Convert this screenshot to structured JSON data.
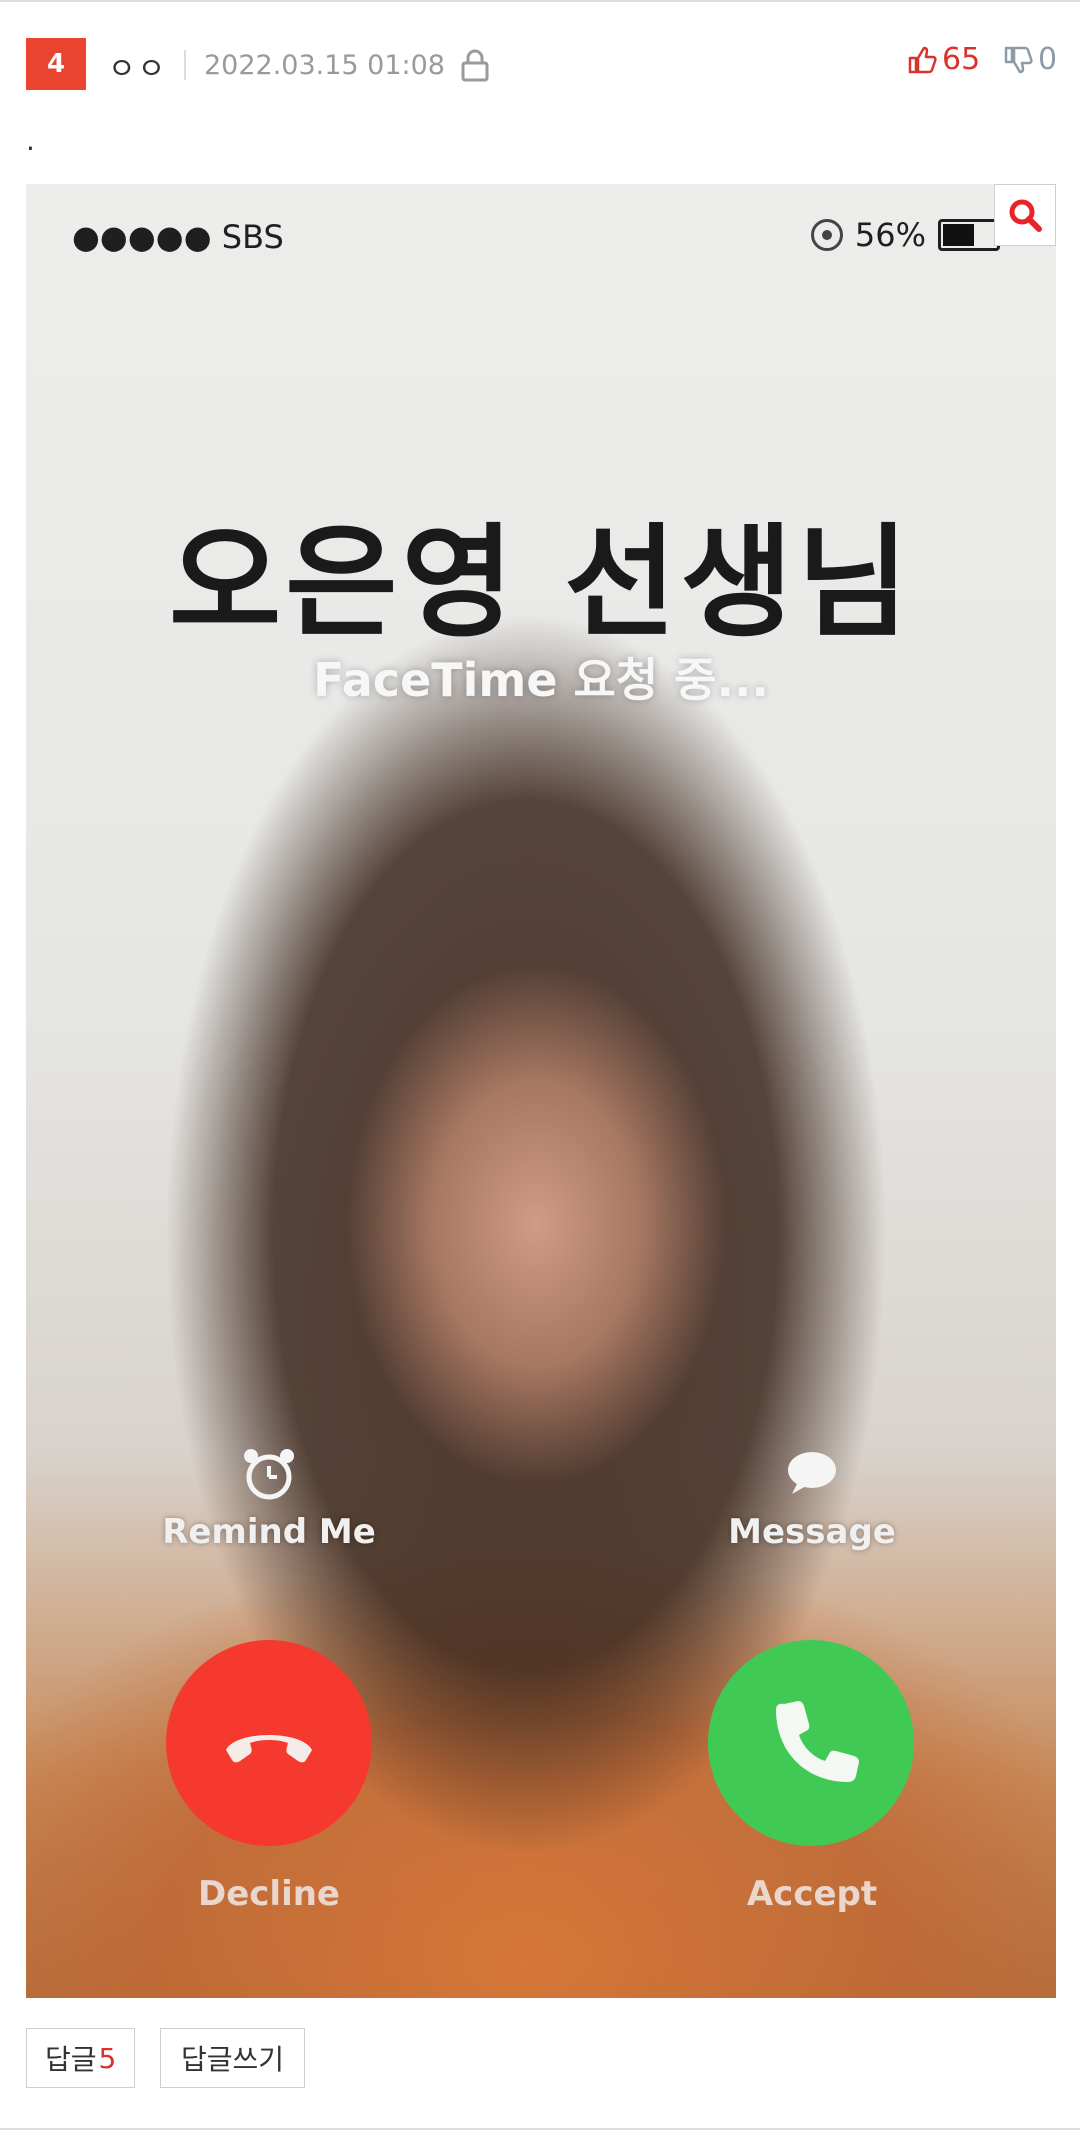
{
  "post": {
    "rank": "4",
    "author": "ㅇㅇ",
    "date": "2022.03.15 01:08",
    "upvotes": "65",
    "downvotes": "0",
    "body_text": "."
  },
  "image": {
    "carrier": "●●●●● SBS",
    "battery_percent": "56%",
    "battery_level": 0.56,
    "caller_name": "오은영 선생님",
    "status": "FaceTime 요청 중...",
    "remind_label": "Remind Me",
    "message_label": "Message",
    "decline_label": "Decline",
    "accept_label": "Accept"
  },
  "footer": {
    "replies_label": "답글",
    "replies_count": "5",
    "write_label": "답글쓰기"
  },
  "colors": {
    "rank_bg": "#e8442f",
    "upvote": "#d9342b",
    "downvote": "#8e9aa4",
    "decline": "#ee3b30",
    "accept": "#45c759"
  },
  "icons": [
    "lock-icon",
    "thumbs-up-icon",
    "thumbs-down-icon",
    "search-icon",
    "alarm-clock-icon",
    "speech-bubble-icon",
    "phone-hangup-icon",
    "phone-icon"
  ]
}
